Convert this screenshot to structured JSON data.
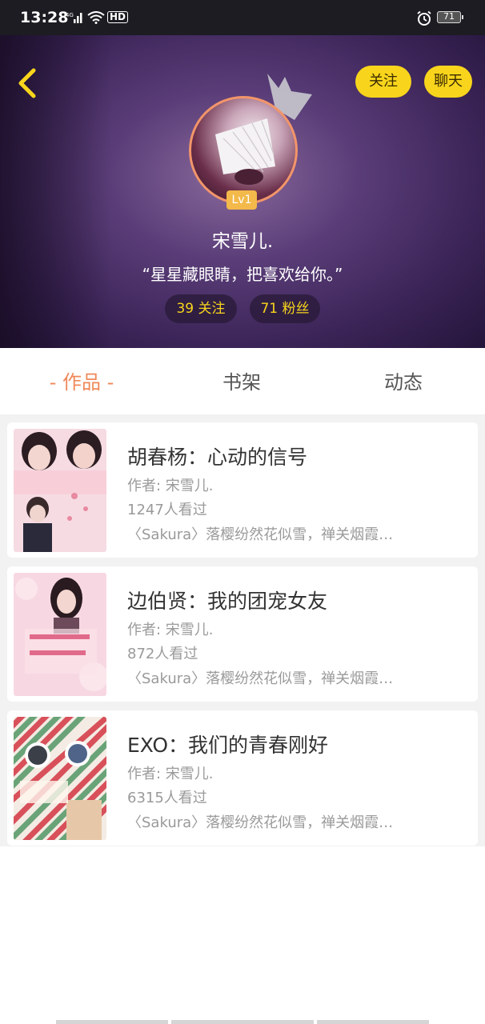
{
  "status_bar": {
    "time": "13:28",
    "signal": "4G",
    "hd": "HD",
    "battery": "71"
  },
  "header": {
    "follow_button": "关注",
    "chat_button": "聊天",
    "level": "Lv1",
    "username": "宋雪儿.",
    "bio": "“星星藏眼睛，把喜欢给你。”",
    "following": "39 关注",
    "fans": "71 粉丝"
  },
  "tabs": [
    {
      "label": "- 作品 -",
      "active": true
    },
    {
      "label": "书架",
      "active": false
    },
    {
      "label": "动态",
      "active": false
    }
  ],
  "works": [
    {
      "title": "胡春杨：心动的信号",
      "author": "作者: 宋雪儿.",
      "views": "1247人看过",
      "description": "〈Sakura〉落樱纷然花似雪，禅关烟霞…"
    },
    {
      "title": "边伯贤：我的团宠女友",
      "author": "作者: 宋雪儿.",
      "views": "872人看过",
      "description": "〈Sakura〉落樱纷然花似雪，禅关烟霞…"
    },
    {
      "title": "EXO：我们的青春刚好",
      "author": "作者: 宋雪儿.",
      "views": "6315人看过",
      "description": "〈Sakura〉落樱纷然花似雪，禅关烟霞…"
    }
  ],
  "colors": {
    "accent_yellow": "#f8d51c",
    "active_tab": "#f0895a",
    "avatar_ring": "#f2956a"
  }
}
